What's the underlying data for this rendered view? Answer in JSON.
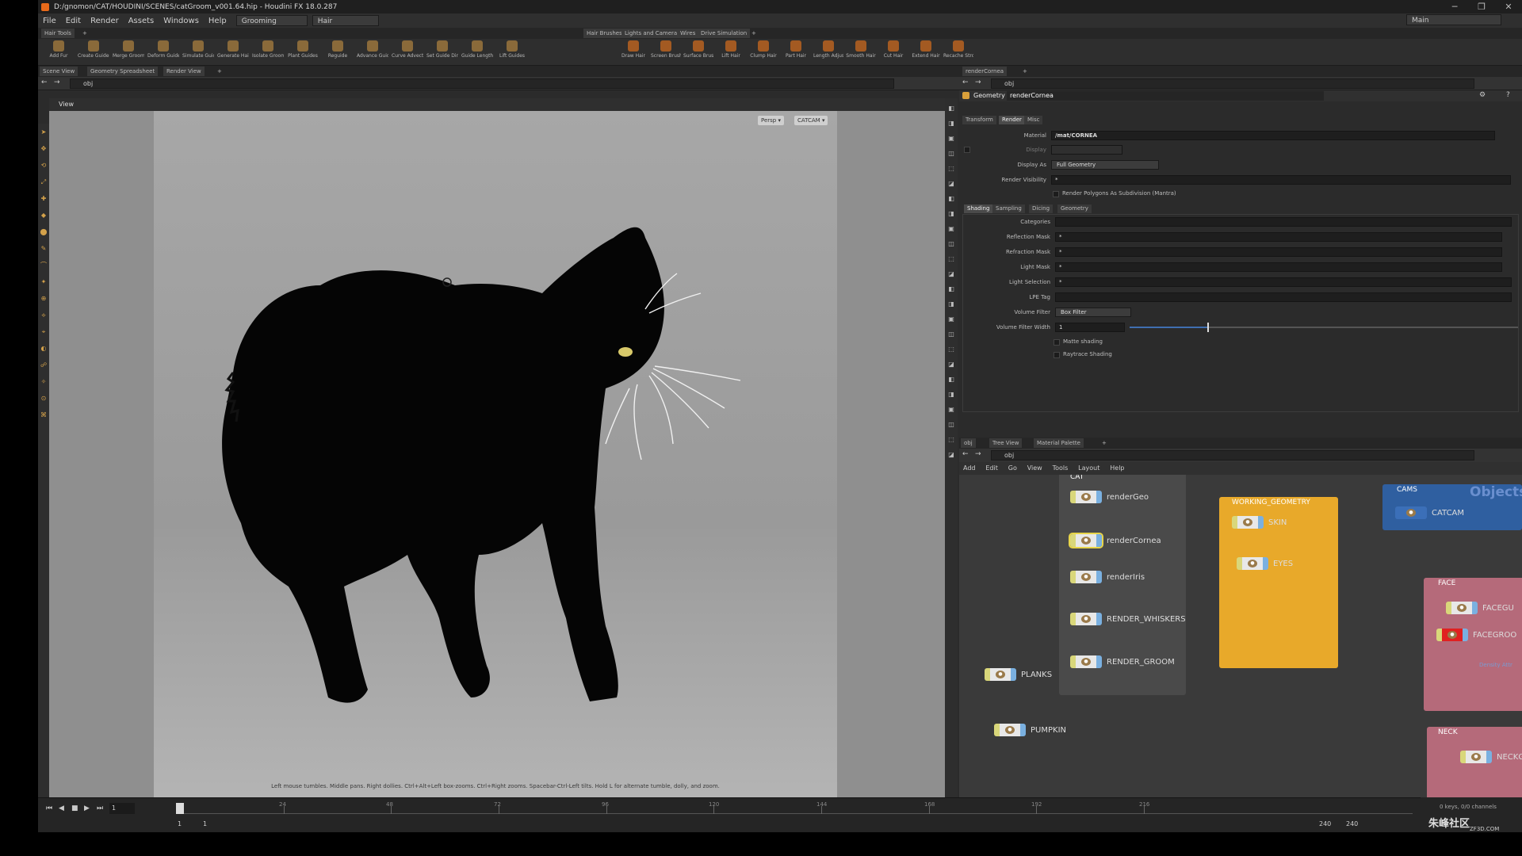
{
  "titlebar": {
    "title": "D:/gnomon/CAT/HOUDINI/SCENES/catGroom_v001.64.hip - Houdini FX 18.0.287",
    "minimize": "─",
    "maximize": "❐",
    "close": "✕"
  },
  "menubar": {
    "items": [
      "File",
      "Edit",
      "Render",
      "Assets",
      "Windows",
      "Help"
    ],
    "desktop": "Grooming",
    "context": "Hair",
    "main_label": "Main"
  },
  "shelf": {
    "tab_left": "Hair Tools",
    "tabs_right": [
      "Hair Brushes",
      "Lights and Cameras",
      "Wires",
      "Drive Simulation"
    ],
    "tools_left": [
      "Add Fur",
      "Create Guides",
      "Merge Groom Objects",
      "Deform Guides",
      "Simulate Guides",
      "Generate Hair",
      "Isolate Groom Parts",
      "Plant Guides",
      "Reguide",
      "Advance Guides",
      "Curve Advect",
      "Set Guide Direction",
      "Guide Length",
      "Lift Guides"
    ],
    "tools_right": [
      "Draw Hair",
      "Screen Brush",
      "Surface Brush",
      "Lift Hair",
      "Clump Hair",
      "Part Hair",
      "Length Adjust",
      "Smooth Hair",
      "Cut Hair",
      "Extend Hair",
      "Recache Strokes"
    ]
  },
  "viewer": {
    "tabs": [
      "Scene View",
      "Geometry Spreadsheet",
      "Render View"
    ],
    "path": "obj",
    "view_label": "View",
    "persp": "Persp ▾",
    "camera": "CATCAM ▾",
    "hint": "Left mouse tumbles. Middle pans. Right dollies. Ctrl+Alt+Left box-zooms. Ctrl+Right zooms. Spacebar-Ctrl-Left tilts. Hold L for alternate tumble, dolly, and zoom."
  },
  "params": {
    "tab": "renderCornea",
    "path": "obj",
    "node_type": "Geometry",
    "node_name": "renderCornea",
    "tabs": [
      "Transform",
      "Render",
      "Misc"
    ],
    "material_label": "Material",
    "material_value": "/mat/CORNEA",
    "display_label": "Display",
    "display_as_label": "Display As",
    "display_as_value": "Full Geometry",
    "render_visibility_label": "Render Visibility",
    "render_visibility_value": "*",
    "render_polygons_label": "Render Polygons As Subdivision (Mantra)",
    "subtabs": [
      "Shading",
      "Sampling",
      "Dicing",
      "Geometry"
    ],
    "rows": [
      {
        "label": "Categories",
        "value": ""
      },
      {
        "label": "Reflection Mask",
        "value": "*"
      },
      {
        "label": "Refraction Mask",
        "value": "*"
      },
      {
        "label": "Light Mask",
        "value": "*"
      },
      {
        "label": "Light Selection",
        "value": "*"
      },
      {
        "label": "LPE Tag",
        "value": ""
      }
    ],
    "volume_filter_label": "Volume Filter",
    "volume_filter_value": "Box Filter",
    "volume_filter_width_label": "Volume Filter Width",
    "volume_filter_width_value": "1",
    "volume_filter_width_slider": 0.2,
    "matte_label": "Matte shading",
    "raytrace_label": "Raytrace Shading"
  },
  "network": {
    "tabs": [
      "obj",
      "Tree View",
      "Material Palette"
    ],
    "path": "obj",
    "menu": [
      "Add",
      "Edit",
      "Go",
      "View",
      "Tools",
      "Layout",
      "Help"
    ],
    "watermark": "Objects",
    "cat_box": "CAT",
    "cat_nodes": [
      "renderGeo",
      "renderCornea",
      "renderIris",
      "RENDER_WHISKERS",
      "RENDER_GROOM"
    ],
    "working_box": "WORKING_GEOMETRY",
    "working_nodes": [
      "SKIN",
      "EYES"
    ],
    "cams_box": "CAMS",
    "cams_nodes": [
      "CATCAM"
    ],
    "face_box": "FACE",
    "face_nodes": [
      "FACEGU",
      "FACEGROO"
    ],
    "face_note": "Density Attr",
    "neck_box": "NECK",
    "neck_nodes": [
      "NECKGUIDES"
    ],
    "loose_nodes": [
      "PLANKS",
      "PUMPKIN"
    ]
  },
  "timeline": {
    "frame": "1",
    "start": "1",
    "start2": "1",
    "end": "240",
    "end2": "240",
    "ticks": [
      "24",
      "48",
      "72",
      "96",
      "120",
      "144",
      "168",
      "192",
      "216"
    ],
    "keys_info": "0 keys, 0/0 channels",
    "watermark_text": "朱峰社区",
    "watermark_url": "ZF3D.COM"
  },
  "colors": {
    "working_box": "#e8a92a",
    "cams_box": "#2f5fa0",
    "face_box": "#b56a7a",
    "neck_box": "#b56a7a",
    "cat_box": "#4a4a4a"
  }
}
